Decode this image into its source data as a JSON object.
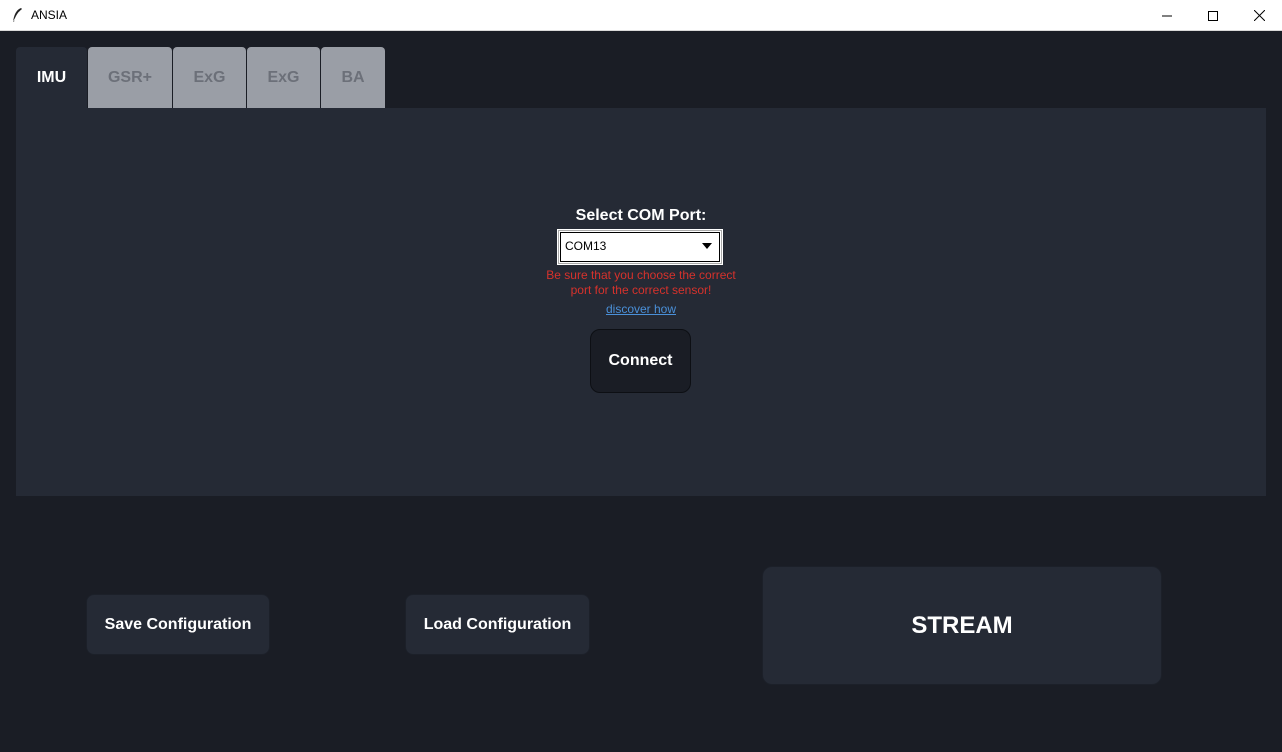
{
  "window": {
    "title": "ANSIA",
    "icon": "feather-icon",
    "controls": [
      "minimize-icon",
      "maximize-icon",
      "close-icon"
    ]
  },
  "tabs": [
    {
      "label": "IMU",
      "active": true
    },
    {
      "label": "GSR+",
      "active": false
    },
    {
      "label": "ExG",
      "active": false
    },
    {
      "label": "ExG",
      "active": false
    },
    {
      "label": "BA",
      "active": false
    }
  ],
  "panel": {
    "port_label": "Select COM Port:",
    "port_value": "COM13",
    "warning_line1": "Be sure that you choose the correct",
    "warning_line2": "port for the correct sensor!",
    "discover_link": "discover how",
    "connect_label": "Connect"
  },
  "actions": {
    "save_label": "Save Configuration",
    "load_label": "Load Configuration",
    "stream_label": "STREAM"
  },
  "colors": {
    "background": "#1a1d25",
    "panel": "#252a35",
    "inactive_tab": "#9a9ea6",
    "warning": "#d6322c",
    "link": "#4a90d9"
  }
}
